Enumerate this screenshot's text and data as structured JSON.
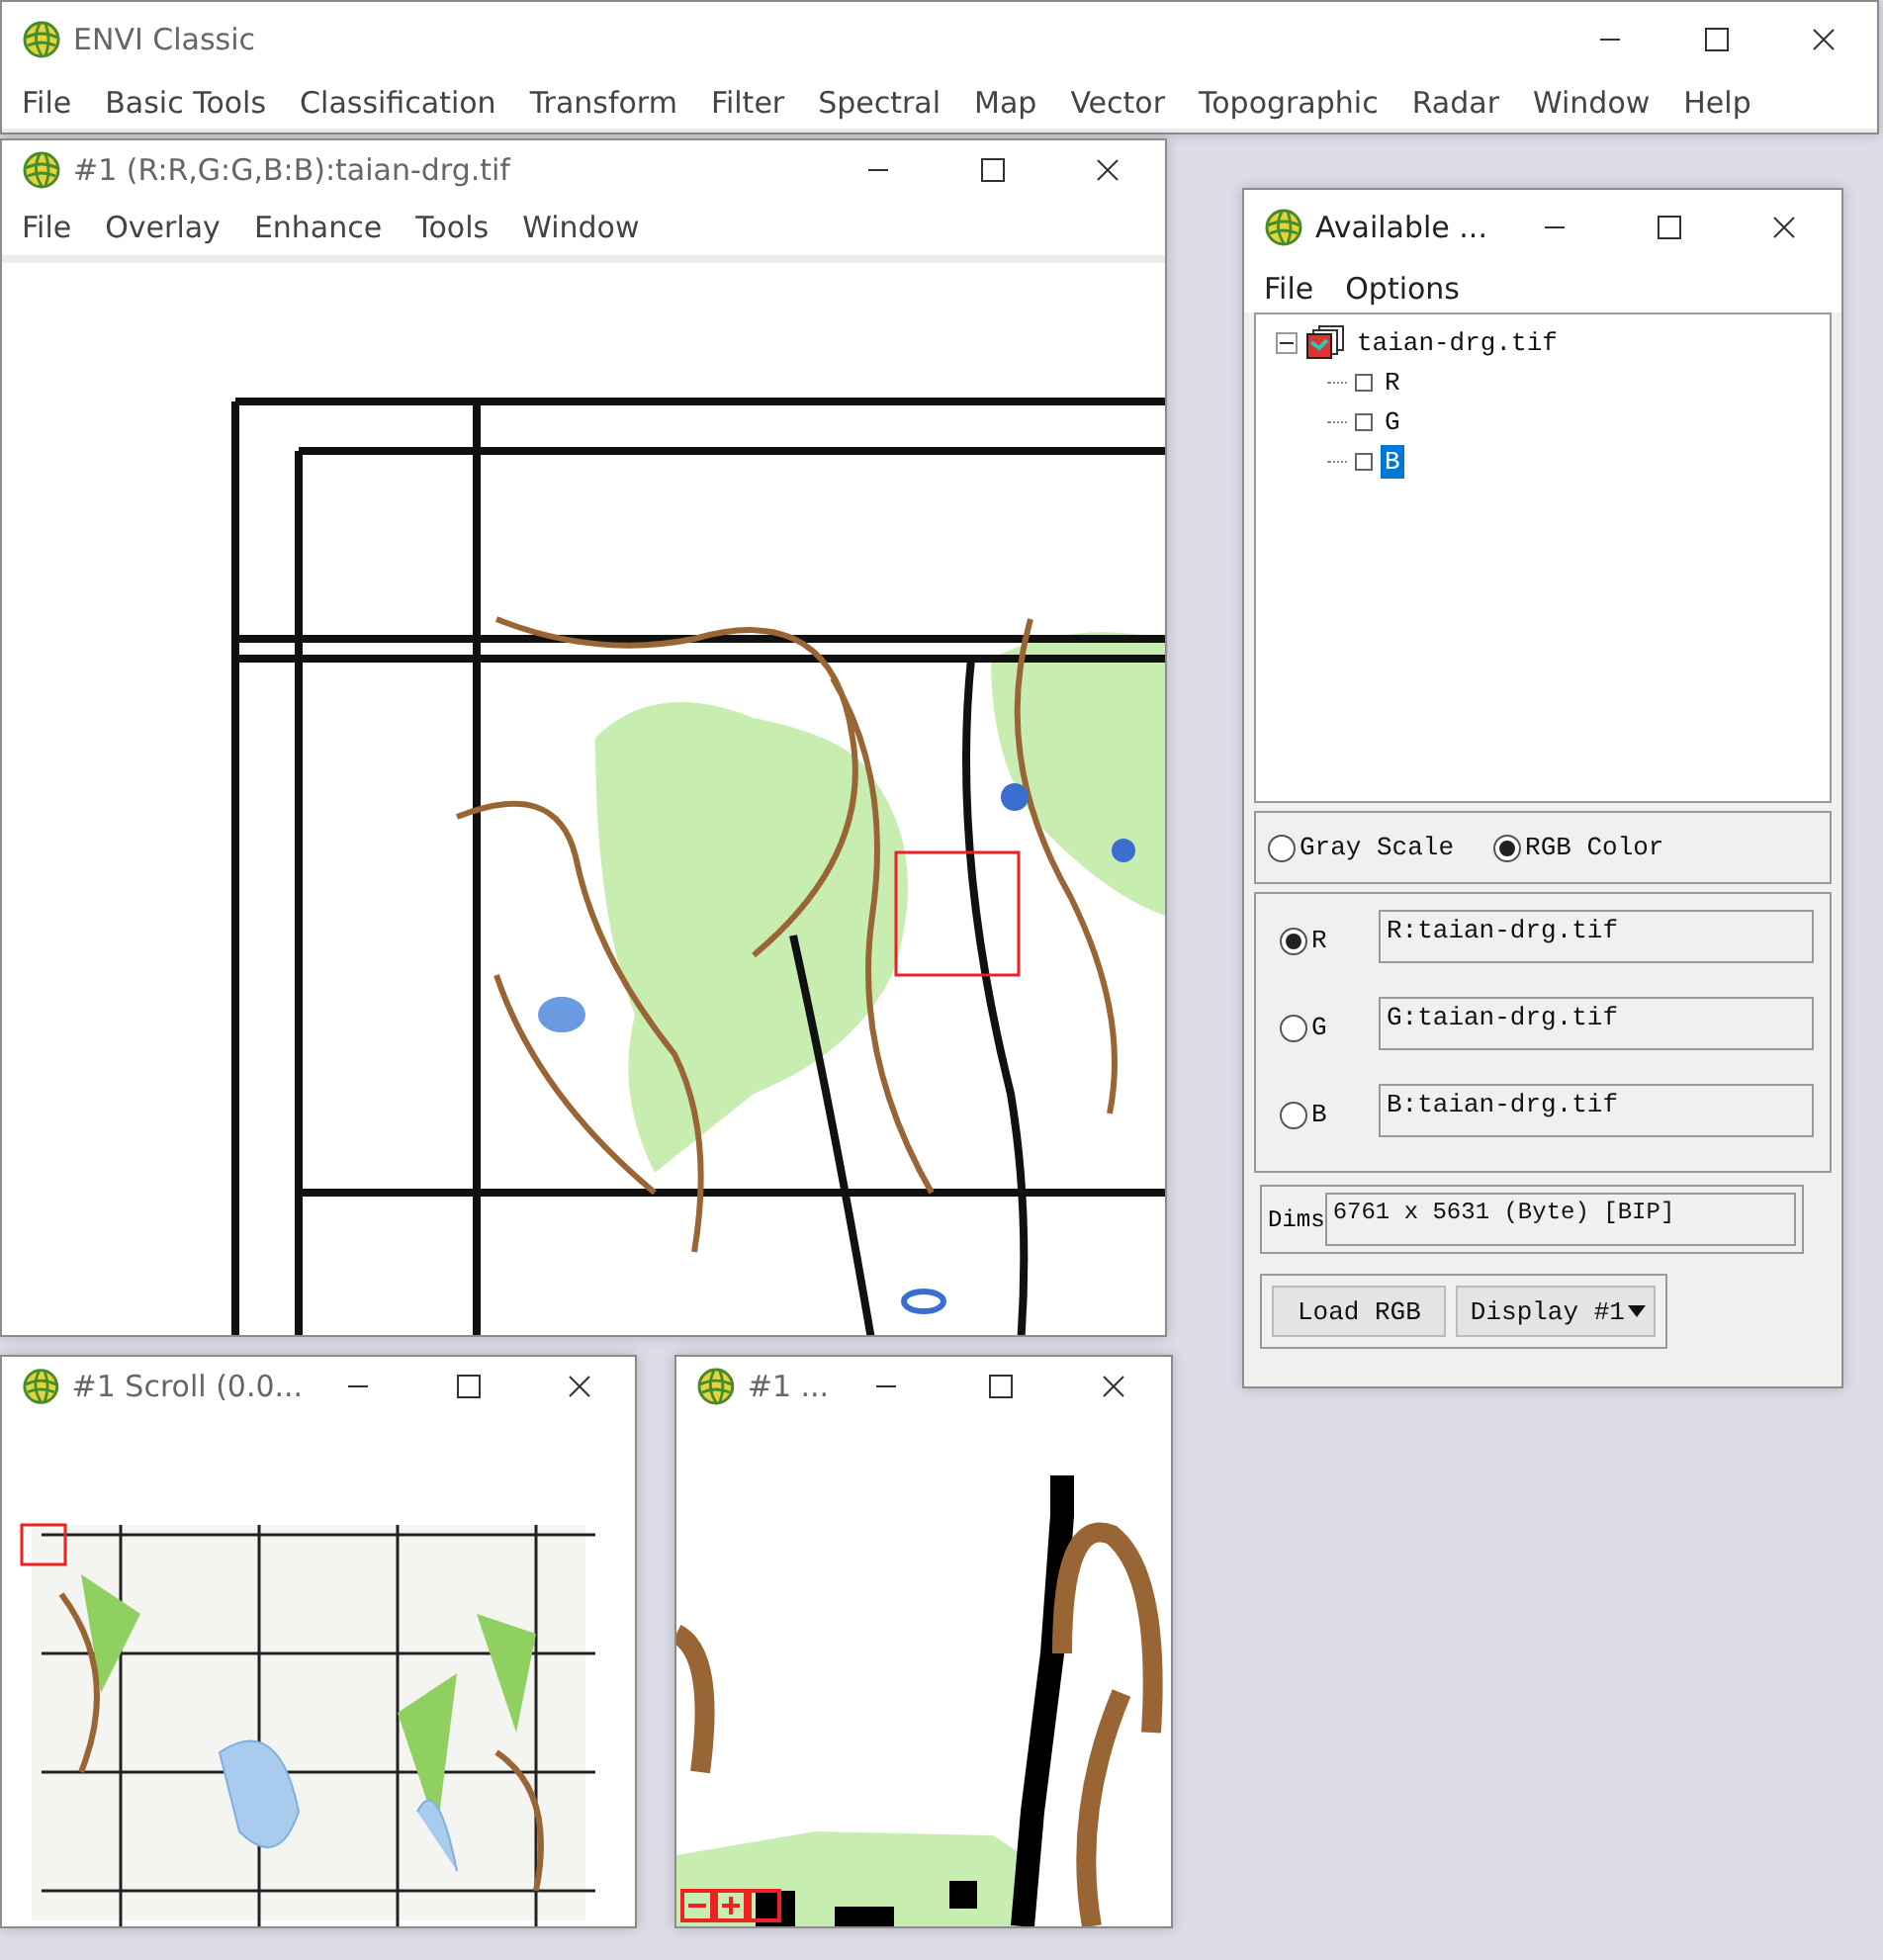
{
  "main_window": {
    "title": "ENVI Classic",
    "menu": [
      "File",
      "Basic Tools",
      "Classification",
      "Transform",
      "Filter",
      "Spectral",
      "Map",
      "Vector",
      "Topographic",
      "Radar",
      "Window",
      "Help"
    ]
  },
  "image_window": {
    "title": "#1 (R:R,G:G,B:B):taian-drg.tif",
    "menu": [
      "File",
      "Overlay",
      "Enhance",
      "Tools",
      "Window"
    ]
  },
  "available_bands": {
    "title": "Available ...",
    "menu": [
      "File",
      "Options"
    ],
    "tree": {
      "label": "taian-drg.tif",
      "expanded": true,
      "children": [
        {
          "label": "R",
          "selected": false
        },
        {
          "label": "G",
          "selected": false
        },
        {
          "label": "B",
          "selected": true
        }
      ]
    },
    "color_modes": [
      {
        "label": "Gray Scale",
        "selected": false
      },
      {
        "label": "RGB Color",
        "selected": true
      }
    ],
    "channels": [
      {
        "label": "R",
        "selected": true,
        "value": "R:taian-drg.tif"
      },
      {
        "label": "G",
        "selected": false,
        "value": "G:taian-drg.tif"
      },
      {
        "label": "B",
        "selected": false,
        "value": "B:taian-drg.tif"
      }
    ],
    "dims": {
      "label": "Dims",
      "value": "6761 x 5631 (Byte) [BIP]"
    },
    "buttons": [
      {
        "label": "Load RGB",
        "kind": "button"
      },
      {
        "label": "Display #1",
        "kind": "dropdown"
      }
    ]
  },
  "scroll_window": {
    "title": "#1 Scroll (0.0..."
  },
  "zoom_window": {
    "title": "#1 ..."
  }
}
